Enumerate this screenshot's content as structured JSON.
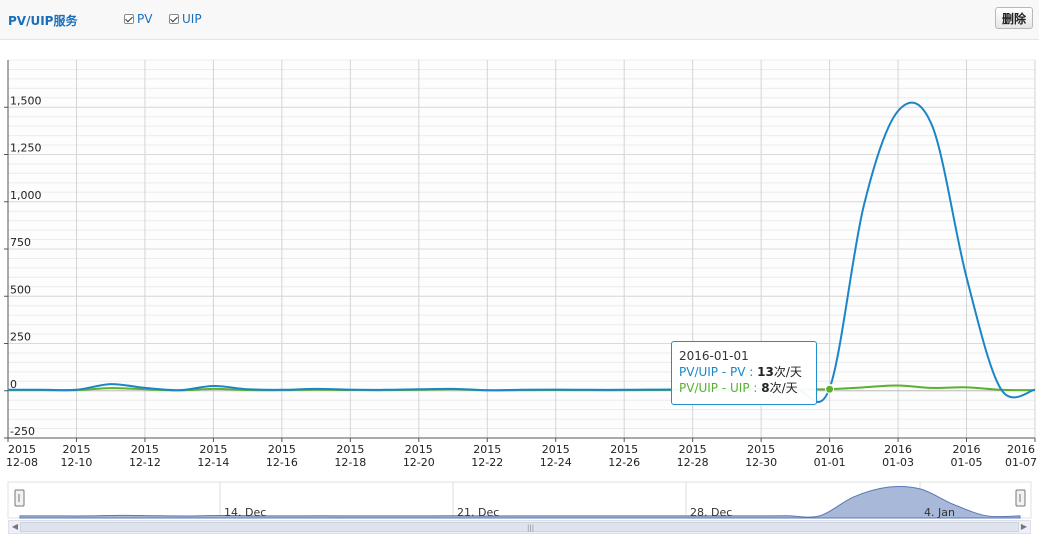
{
  "header": {
    "title": "PV/UIP服务",
    "checkboxes": [
      {
        "label": "PV",
        "checked": true
      },
      {
        "label": "UIP",
        "checked": true
      }
    ],
    "delete_label": "删除"
  },
  "tooltip": {
    "date": "2016-01-01",
    "pv_prefix": "PV/UIP - PV : ",
    "pv_value": "13",
    "uip_prefix": "PV/UIP - UIP : ",
    "uip_value": "8",
    "unit": "次/天"
  },
  "navigator": {
    "labels": [
      "14. Dec",
      "21. Dec",
      "28. Dec",
      "4. Jan"
    ]
  },
  "chart_data": {
    "type": "line",
    "ylim": [
      -250,
      1750
    ],
    "yticks": [
      -250,
      0,
      250,
      500,
      750,
      1000,
      1250,
      1500
    ],
    "ytick_labels": [
      "-250",
      "0",
      "250",
      "500",
      "750",
      "1,000",
      "1,250",
      "1,500"
    ],
    "x": [
      "2015-12-08",
      "2015-12-09",
      "2015-12-10",
      "2015-12-11",
      "2015-12-12",
      "2015-12-13",
      "2015-12-14",
      "2015-12-15",
      "2015-12-16",
      "2015-12-17",
      "2015-12-18",
      "2015-12-19",
      "2015-12-20",
      "2015-12-21",
      "2015-12-22",
      "2015-12-23",
      "2015-12-24",
      "2015-12-25",
      "2015-12-26",
      "2015-12-27",
      "2015-12-28",
      "2015-12-29",
      "2015-12-30",
      "2015-12-31",
      "2016-01-01",
      "2016-01-02",
      "2016-01-03",
      "2016-01-04",
      "2016-01-05",
      "2016-01-06",
      "2016-01-07"
    ],
    "xtick_labels": [
      [
        "2015",
        "12-08"
      ],
      [
        "2015",
        "12-10"
      ],
      [
        "2015",
        "12-12"
      ],
      [
        "2015",
        "12-14"
      ],
      [
        "2015",
        "12-16"
      ],
      [
        "2015",
        "12-18"
      ],
      [
        "2015",
        "12-20"
      ],
      [
        "2015",
        "12-22"
      ],
      [
        "2015",
        "12-24"
      ],
      [
        "2015",
        "12-26"
      ],
      [
        "2015",
        "12-28"
      ],
      [
        "2015",
        "12-30"
      ],
      [
        "2016",
        "01-01"
      ],
      [
        "2016",
        "01-03"
      ],
      [
        "2016",
        "01-05"
      ],
      [
        "2016",
        "01-07"
      ]
    ],
    "series": [
      {
        "name": "PV",
        "color": "#1a86c8",
        "values": [
          5,
          5,
          5,
          35,
          15,
          3,
          25,
          8,
          5,
          10,
          6,
          5,
          8,
          10,
          3,
          5,
          6,
          5,
          5,
          6,
          7,
          8,
          9,
          10,
          13,
          980,
          1480,
          1400,
          600,
          10,
          5
        ]
      },
      {
        "name": "UIP",
        "color": "#5cb030",
        "values": [
          3,
          3,
          3,
          14,
          8,
          2,
          10,
          4,
          3,
          6,
          4,
          3,
          5,
          8,
          2,
          3,
          4,
          3,
          3,
          4,
          5,
          5,
          6,
          7,
          8,
          18,
          28,
          15,
          18,
          5,
          3
        ]
      }
    ],
    "highlight_index": 24,
    "grid": true
  }
}
